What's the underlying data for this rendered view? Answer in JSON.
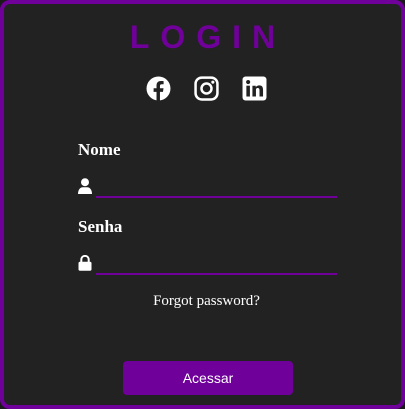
{
  "form": {
    "title": "LOGIN",
    "socials": [
      {
        "icon": "facebook-icon"
      },
      {
        "icon": "instagram-icon"
      },
      {
        "icon": "linkedin-icon"
      }
    ],
    "username": {
      "label": "Nome",
      "value": "",
      "icon": "user-icon"
    },
    "password": {
      "label": "Senha",
      "value": "",
      "icon": "lock-icon"
    },
    "forgot_label": "Forgot password?",
    "submit_label": "Acessar"
  },
  "colors": {
    "accent": "#6f0099",
    "background": "#222222",
    "text": "#ffffff"
  }
}
